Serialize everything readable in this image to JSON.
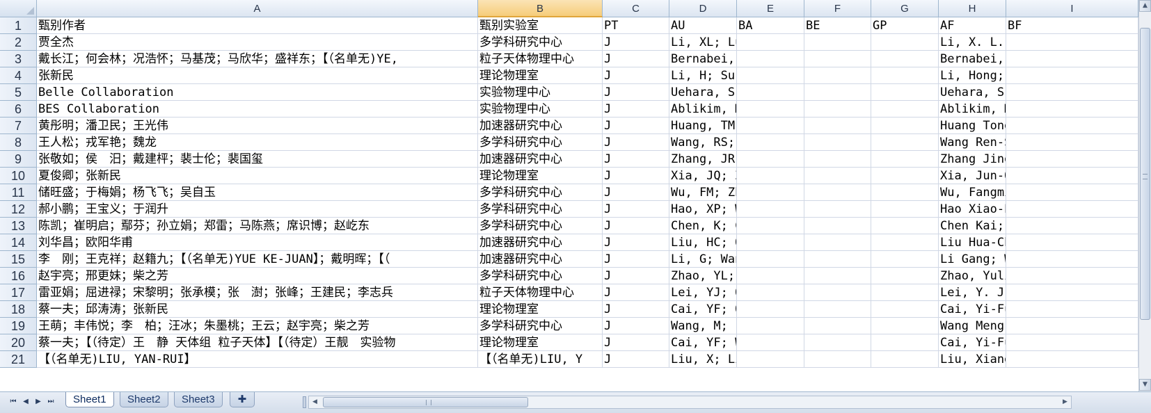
{
  "columns": [
    "A",
    "B",
    "C",
    "D",
    "E",
    "F",
    "G",
    "H",
    "I"
  ],
  "selected_column": "B",
  "rows": [
    {
      "num": "1",
      "A": "甄别作者",
      "B": "甄别实验室",
      "C": "PT",
      "D": "AU",
      "E": "BA",
      "F": "BE",
      "G": "GP",
      "H": "AF",
      "I": "BF"
    },
    {
      "num": "2",
      "A": "贾全杰",
      "B": "多学科研究中心",
      "C": "J",
      "D": "Li, XL; Lu, HB; Li, M; Mai, ZH; Kim,",
      "H": "Li, X. L.; Lu, H."
    },
    {
      "num": "3",
      "A": "戴长江；何会林；况浩怀；马基茂；马欣华；盛祥东；【（名单无)YE,",
      "B": "粒子天体物理中心",
      "C": "J",
      "D": "Bernabei, R; Belli, P; Montecchia, F",
      "H": "Bernabei, R.; Bell"
    },
    {
      "num": "4",
      "A": "张新民",
      "B": "理论物理室",
      "C": "J",
      "D": "Li, H; Su, M; Fan, ZH; Dai, ZG; Zhar",
      "H": "Li, Hong; Su, Meng"
    },
    {
      "num": "5",
      "A": "Belle Collaboration",
      "B": "实验物理中心",
      "C": "J",
      "D": "Uehara, S; Adachi, I; Aihara, H; Aul",
      "H": "Uehara, S.; Adachi"
    },
    {
      "num": "6",
      "A": "BES Collaboration",
      "B": "实验物理中心",
      "C": "J",
      "D": "Ablikim, M; Bai, JZ; Ban, Y; Cai, X;",
      "H": "Ablikim, M.; Bai,"
    },
    {
      "num": "7",
      "A": "黄彤明；潘卫民；王光伟",
      "B": "加速器研究中心",
      "C": "J",
      "D": "Huang, TM; Pan, WM; Wang, GW; Furuya",
      "H": "Huang Tong-Ming; P"
    },
    {
      "num": "8",
      "A": "王人松；戎军艳；魏龙",
      "B": "多学科研究中心",
      "C": "J",
      "D": "Wang, RS; Rong, JY; Wei, L",
      "H": "Wang Ren-Song; Ron"
    },
    {
      "num": "9",
      "A": "张敬如；侯　汨；戴建枰；裴士伦；裴国玺",
      "B": "加速器研究中心",
      "C": "J",
      "D": "Zhang, JR; Hou, M; Dai, JP; Pei, SL;",
      "H": "Zhang Jing-Ru; Hou"
    },
    {
      "num": "10",
      "A": "夏俊卿；张新民",
      "B": "理论物理室",
      "C": "J",
      "D": "Xia, JQ; Zhang, XM",
      "H": "Xia, Jun-Qing; Zha"
    },
    {
      "num": "11",
      "A": "储旺盛；于梅娟；杨飞飞；吴自玉",
      "B": "多学科研究中心",
      "C": "J",
      "D": "Wu, FM; Zhang, JH; Sun, JP; Huang, F",
      "H": "Wu, Fangming; Zhan"
    },
    {
      "num": "12",
      "A": "郝小鹏；王宝义；于润升",
      "B": "多学科研究中心",
      "C": "J",
      "D": "Hao, XP; Wang, BY; Yu, RS; Wei, L; W",
      "H": "Hao Xiao-Peng; Wan"
    },
    {
      "num": "13",
      "A": "陈凯；崔明启；鄢芬；孙立娟；郑雷；马陈燕；席识博；赵屹东",
      "B": "多学科研究中心",
      "C": "J",
      "D": "Chen, K; Cui, MQ; Yan, F; Zhao, J; S",
      "H": "Chen Kai; Cui Ming"
    },
    {
      "num": "14",
      "A": "刘华昌；欧阳华甫",
      "B": "加速器研究中心",
      "C": "J",
      "D": "Liu, HC; Ouyang, HF",
      "H": "Liu Hua-Chang; Ouy"
    },
    {
      "num": "15",
      "A": "李　刚；王克祥；赵籍九；【（名单无)YUE KE-JUAN】；戴明晖；【（",
      "B": "加速器研究中心",
      "C": "J",
      "D": "Li, G; Wang, KX; Zhao, JJ; Yue, KJ;",
      "H": "Li Gang; Wang Ke-X"
    },
    {
      "num": "16",
      "A": "赵宇亮；邢更妹；柴之芳",
      "B": "多学科研究中心",
      "C": "J",
      "D": "Zhao, YL; Xing, GM; Chai, ZF",
      "H": "Zhao, Yuliang; Xin"
    },
    {
      "num": "17",
      "A": "雷亚娟；屈进禄；宋黎明；张承模；张　澍；张峰；王建民；李志兵",
      "B": "粒子天体物理中心",
      "C": "J",
      "D": "Lei, YJ; Qu, JL; Song, LM; Zhang, CM",
      "H": "Lei, Y. J.; Qu, J."
    },
    {
      "num": "18",
      "A": "蔡一夫；邱涛涛；张新民",
      "B": "理论物理室",
      "C": "J",
      "D": "Cai, YF; Qiu, TT; Brandenberger, R;",
      "H": "Cai, Yi-Fu; Qiu, T"
    },
    {
      "num": "19",
      "A": "王萌；丰伟悦；李　柏；汪冰；朱墨桃；王云；赵宇亮；柴之芳",
      "B": "多学科研究中心",
      "C": "J",
      "D": "Wang, M; Feng, WY; Lu, WW; Li, B; Wa",
      "H": "Wang Meng; Feng We"
    },
    {
      "num": "20",
      "A": "蔡一夫；【（待定）王　静 天体组 粒子天体】【（待定）王靓　实验物",
      "B": "理论物理室",
      "C": "J",
      "D": "Cai, YF; Wang, J",
      "H": "Cai, Yi-Fu; Wang,"
    },
    {
      "num": "21",
      "A": "【（名单无)LIU, YAN-RUI】",
      "B": "【（名单无)LIU, Y",
      "C": "J",
      "D": "Liu, X; Liu, YR; Deng, WZ; Zhu, SL",
      "H": "Liu, Xiang; Liu, Y"
    }
  ],
  "sheet_tabs": [
    {
      "label": "Sheet1",
      "active": true
    },
    {
      "label": "Sheet2",
      "active": false
    },
    {
      "label": "Sheet3",
      "active": false
    }
  ],
  "new_sheet_icon": "insert-worksheet-icon",
  "nav_icons": [
    "first-sheet-icon",
    "prev-sheet-icon",
    "next-sheet-icon",
    "last-sheet-icon"
  ],
  "colors": {
    "grid": "#d0d7e5",
    "header": "#dce5f1",
    "selected_header": "#f6cd7a"
  }
}
